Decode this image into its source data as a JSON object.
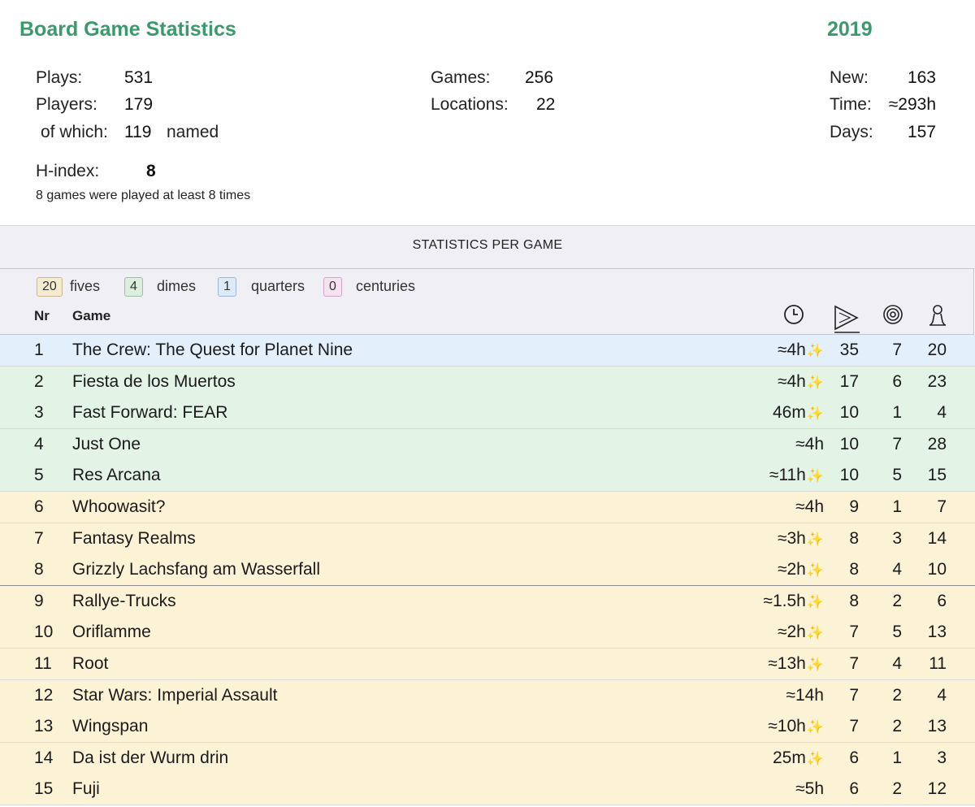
{
  "header": {
    "title": "Board Game Statistics",
    "year": "2019"
  },
  "summary": {
    "plays_label": "Plays:",
    "plays": "531",
    "players_label": "Players:",
    "players": "179",
    "of_which_label": "of which:",
    "named_count": "119",
    "named_label": "named",
    "games_label": "Games:",
    "games": "256",
    "locations_label": "Locations:",
    "locations": "22",
    "new_label": "New:",
    "new": "163",
    "time_label": "Time:",
    "time": "≈293h",
    "days_label": "Days:",
    "days": "157",
    "hindex_label": "H-index:",
    "hindex": "8",
    "hindex_note": "8 games were played at least 8 times"
  },
  "section": {
    "title": "STATISTICS PER GAME"
  },
  "legend": [
    {
      "count": "20",
      "label": "fives",
      "bg": "#f5ecd0",
      "border": "#c9b98a"
    },
    {
      "count": "4",
      "label": "dimes",
      "bg": "#dcefdf",
      "border": "#9fbfa5"
    },
    {
      "count": "1",
      "label": "quarters",
      "bg": "#ddeaf7",
      "border": "#9db6cf"
    },
    {
      "count": "0",
      "label": "centuries",
      "bg": "#f6e2f1",
      "border": "#cfa6c5"
    }
  ],
  "columns": {
    "nr": "Nr",
    "game": "Game",
    "icons": [
      "clock-icon",
      "play-icon",
      "target-icon",
      "player-icon"
    ]
  },
  "colors": {
    "blue": "#e3f0fb",
    "green": "#e3f3e6",
    "yellow": "#fcf2d6",
    "accent": "#3a9a6c"
  },
  "games": [
    {
      "nr": "1",
      "name": "The Crew: The Quest for Planet Nine",
      "time": "≈4h",
      "new": true,
      "plays": "35",
      "wins": "7",
      "players": "20",
      "tier": "blue"
    },
    {
      "nr": "2",
      "name": "Fiesta de los Muertos",
      "time": "≈4h",
      "new": true,
      "plays": "17",
      "wins": "6",
      "players": "23",
      "tier": "green"
    },
    {
      "nr": "3",
      "name": "Fast Forward: FEAR",
      "time": "46m",
      "new": true,
      "plays": "10",
      "wins": "1",
      "players": "4",
      "tier": "green"
    },
    {
      "nr": "4",
      "name": "Just One",
      "time": "≈4h",
      "new": false,
      "plays": "10",
      "wins": "7",
      "players": "28",
      "tier": "green"
    },
    {
      "nr": "5",
      "name": "Res Arcana",
      "time": "≈11h",
      "new": true,
      "plays": "10",
      "wins": "5",
      "players": "15",
      "tier": "green"
    },
    {
      "nr": "6",
      "name": "Whoowasit?",
      "time": "≈4h",
      "new": false,
      "plays": "9",
      "wins": "1",
      "players": "7",
      "tier": "yellow"
    },
    {
      "nr": "7",
      "name": "Fantasy Realms",
      "time": "≈3h",
      "new": true,
      "plays": "8",
      "wins": "3",
      "players": "14",
      "tier": "yellow"
    },
    {
      "nr": "8",
      "name": "Grizzly Lachsfang am Wasserfall",
      "time": "≈2h",
      "new": true,
      "plays": "8",
      "wins": "4",
      "players": "10",
      "tier": "yellow"
    },
    {
      "nr": "9",
      "name": "Rallye-Trucks",
      "time": "≈1.5h",
      "new": true,
      "plays": "8",
      "wins": "2",
      "players": "6",
      "tier": "yellow"
    },
    {
      "nr": "10",
      "name": "Oriflamme",
      "time": "≈2h",
      "new": true,
      "plays": "7",
      "wins": "5",
      "players": "13",
      "tier": "yellow"
    },
    {
      "nr": "11",
      "name": "Root",
      "time": "≈13h",
      "new": true,
      "plays": "7",
      "wins": "4",
      "players": "11",
      "tier": "yellow"
    },
    {
      "nr": "12",
      "name": "Star Wars: Imperial Assault",
      "time": "≈14h",
      "new": false,
      "plays": "7",
      "wins": "2",
      "players": "4",
      "tier": "yellow"
    },
    {
      "nr": "13",
      "name": "Wingspan",
      "time": "≈10h",
      "new": true,
      "plays": "7",
      "wins": "2",
      "players": "13",
      "tier": "yellow"
    },
    {
      "nr": "14",
      "name": "Da ist der Wurm drin",
      "time": "25m",
      "new": true,
      "plays": "6",
      "wins": "1",
      "players": "3",
      "tier": "yellow"
    },
    {
      "nr": "15",
      "name": "Fuji",
      "time": "≈5h",
      "new": false,
      "plays": "6",
      "wins": "2",
      "players": "12",
      "tier": "yellow"
    }
  ]
}
